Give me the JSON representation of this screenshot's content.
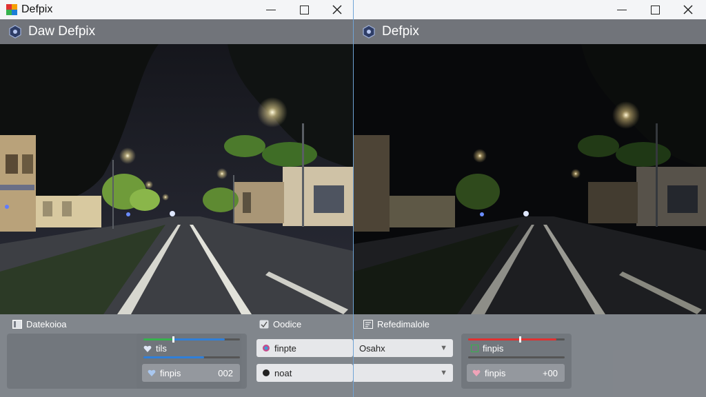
{
  "colors": {
    "accent_blue": "#2f7fd9",
    "accent_green": "#37b24d",
    "accent_red": "#e03131",
    "titlebar": "#f4f5f7"
  },
  "left_window": {
    "title": "Defpix",
    "app_header": "Daw Defpix",
    "panel_label": "Datekoioa",
    "adjust_card": {
      "field1_label": "tils",
      "field2_label": "finpis",
      "field2_value": "002"
    },
    "dropdown_section": {
      "label": "Oodice",
      "dropdown1_value": "finpte",
      "dropdown1_option": "Osahx",
      "dropdown2_value": "noat"
    }
  },
  "right_window": {
    "app_header": "Defpix",
    "panel_label": "Refedimalole",
    "adjust_card": {
      "field1_label": "finpis",
      "field2_label": "finpis",
      "field2_value": "+00"
    }
  },
  "icons": [
    "app-logo-icon",
    "hexagon-logo-icon",
    "minimize-icon",
    "maximize-icon",
    "close-icon",
    "panel-icon",
    "heart-icon",
    "color-dot-icon",
    "chevron-down-icon"
  ]
}
